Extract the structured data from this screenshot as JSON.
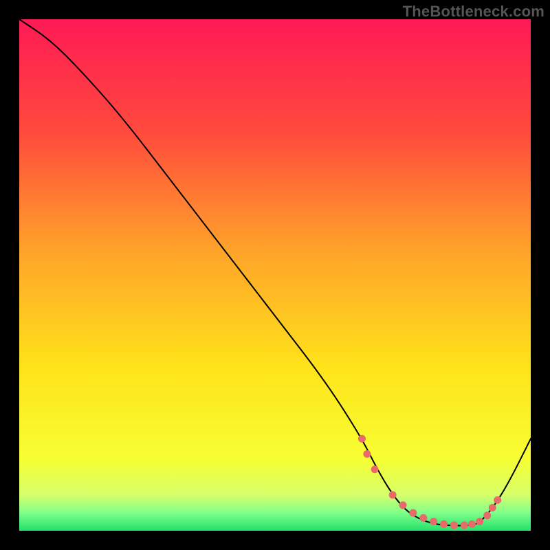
{
  "watermark": {
    "text": "TheBottleneck.com"
  },
  "colors": {
    "background": "#000000",
    "curve": "#000000",
    "marker": "#e86a6a",
    "gradient_stops": [
      {
        "offset": 0.0,
        "color": "#ff1a55"
      },
      {
        "offset": 0.22,
        "color": "#ff4a3d"
      },
      {
        "offset": 0.45,
        "color": "#ffa22a"
      },
      {
        "offset": 0.68,
        "color": "#ffe31a"
      },
      {
        "offset": 0.86,
        "color": "#f7ff33"
      },
      {
        "offset": 0.93,
        "color": "#d6ff6a"
      },
      {
        "offset": 0.965,
        "color": "#7fff8a"
      },
      {
        "offset": 1.0,
        "color": "#22e06a"
      }
    ]
  },
  "chart_data": {
    "type": "line",
    "title": "",
    "xlabel": "",
    "ylabel": "",
    "xlim": [
      0,
      100
    ],
    "ylim": [
      0,
      100
    ],
    "grid": false,
    "legend": null,
    "series": [
      {
        "name": "curve",
        "x": [
          0,
          6,
          12,
          20,
          30,
          40,
          50,
          60,
          67,
          70,
          73,
          76,
          80,
          84,
          88,
          90,
          93,
          96,
          100
        ],
        "y": [
          100,
          96,
          90,
          81,
          68,
          55,
          42,
          29,
          18,
          12,
          7,
          3.5,
          1.5,
          1.0,
          1.0,
          1.5,
          5,
          10,
          18
        ]
      }
    ],
    "markers": {
      "name": "highlight-points",
      "x": [
        67,
        68,
        69.5,
        73,
        75,
        77,
        79,
        81,
        83,
        85,
        87,
        88.5,
        90,
        91.5,
        92.5,
        93.5
      ],
      "y": [
        18,
        15,
        12,
        7,
        5,
        3.5,
        2.5,
        1.8,
        1.3,
        1.1,
        1.1,
        1.3,
        1.8,
        3.0,
        4.5,
        6.0
      ]
    }
  }
}
